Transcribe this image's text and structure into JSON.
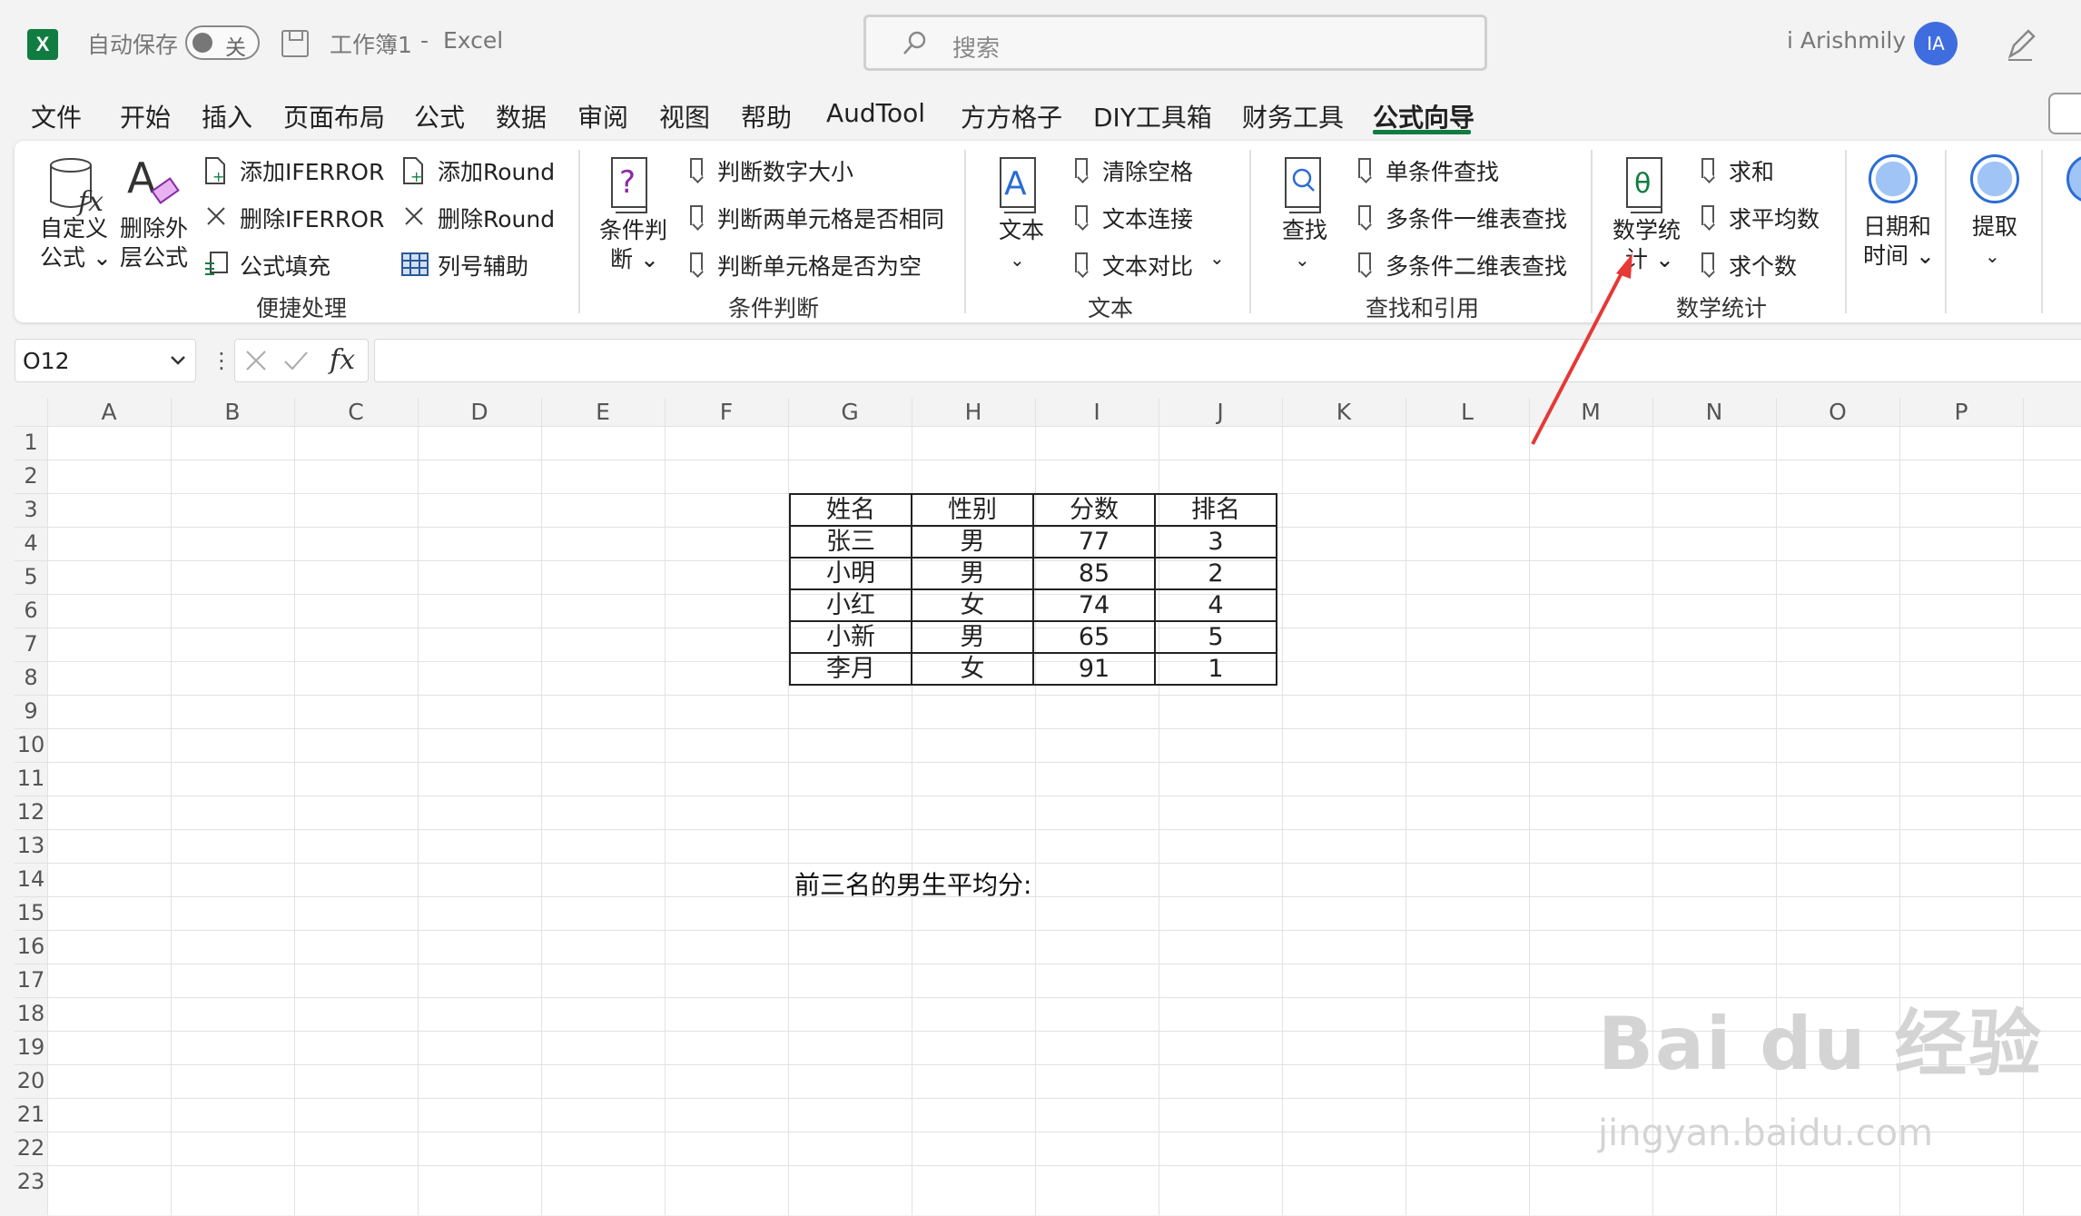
{
  "titlebar": {
    "autosave_label": "自动保存",
    "autosave_state": "关",
    "doc_title": "工作簿1",
    "separator": "-",
    "app_name": "Excel",
    "search_placeholder": "搜索",
    "user_name": "i Arishmily",
    "avatar_initials": "IA"
  },
  "tabs": [
    "文件",
    "开始",
    "插入",
    "页面布局",
    "公式",
    "数据",
    "审阅",
    "视图",
    "帮助",
    "AudTool",
    "方方格子",
    "DIY工具箱",
    "财务工具",
    "公式向导"
  ],
  "active_tab": "公式向导",
  "ribbon": {
    "group1": {
      "label": "便捷处理",
      "custom_formula": [
        "自定义",
        "公式 ⌄"
      ],
      "remove_outer": [
        "删除外",
        "层公式"
      ],
      "items": [
        "添加IFERROR",
        "删除IFERROR",
        "公式填充",
        "添加Round",
        "删除Round",
        "列号辅助"
      ]
    },
    "group2": {
      "label": "条件判断",
      "big": [
        "条件判",
        "断 ⌄"
      ],
      "items": [
        "判断数字大小",
        "判断两单元格是否相同",
        "判断单元格是否为空"
      ]
    },
    "group3": {
      "label": "文本",
      "big": "文本",
      "items": [
        "清除空格",
        "文本连接",
        "文本对比"
      ]
    },
    "group4": {
      "label": "查找和引用",
      "big": "查找",
      "items": [
        "单条件查找",
        "多条件一维表查找",
        "多条件二维表查找"
      ]
    },
    "group5": {
      "label": "数学统计",
      "big": [
        "数学统",
        "计 ⌄"
      ],
      "items": [
        "求和",
        "求平均数",
        "求个数"
      ]
    },
    "group6": {
      "big": [
        "日期和",
        "时间 ⌄"
      ]
    },
    "group7": {
      "big": "提取"
    }
  },
  "formula_bar": {
    "name_box": "O12",
    "fx": "fx",
    "value": ""
  },
  "columns": [
    "A",
    "B",
    "C",
    "D",
    "E",
    "F",
    "G",
    "H",
    "I",
    "J",
    "K",
    "L",
    "M",
    "N",
    "O",
    "P"
  ],
  "rows": [
    "1",
    "2",
    "3",
    "4",
    "5",
    "6",
    "7",
    "8",
    "9",
    "10",
    "11",
    "12",
    "13",
    "14",
    "15",
    "16",
    "17",
    "18",
    "19",
    "20",
    "21",
    "22",
    "23"
  ],
  "table": {
    "headers": [
      "姓名",
      "性别",
      "分数",
      "排名"
    ],
    "rows": [
      [
        "张三",
        "男",
        "77",
        "3"
      ],
      [
        "小明",
        "男",
        "85",
        "2"
      ],
      [
        "小红",
        "女",
        "74",
        "4"
      ],
      [
        "小新",
        "男",
        "65",
        "5"
      ],
      [
        "李月",
        "女",
        "91",
        "1"
      ]
    ]
  },
  "note": "前三名的男生平均分:",
  "watermark": {
    "brand": "Bai du 经验",
    "url": "jingyan.baidu.com"
  },
  "colors": {
    "accent": "#107c41",
    "annotation_arrow": "#e53935",
    "avatar": "#3f6de0"
  }
}
